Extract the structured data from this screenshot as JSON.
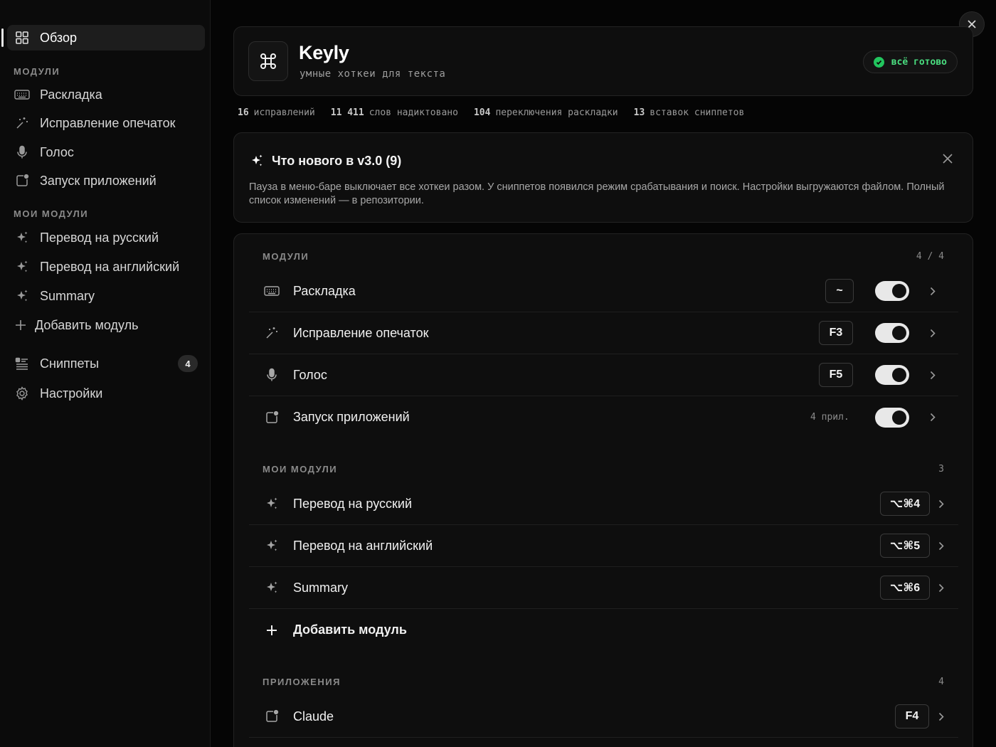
{
  "sidebar": {
    "overview": "Обзор",
    "modules_heading": "МОДУЛИ",
    "modules": [
      "Раскладка",
      "Исправление опечаток",
      "Голос",
      "Запуск приложений"
    ],
    "my_modules_heading": "МОИ МОДУЛИ",
    "my_modules": [
      "Перевод на русский",
      "Перевод на английский",
      "Summary"
    ],
    "add_module": "Добавить модуль",
    "snippets": "Сниппеты",
    "snippets_count": "4",
    "settings": "Настройки"
  },
  "header": {
    "title": "Keyly",
    "subtitle": "умные хоткеи для текста",
    "status": "всё готово"
  },
  "stats": [
    {
      "value": "16",
      "label": "исправлений"
    },
    {
      "value": "11 411",
      "label": "слов надиктовано"
    },
    {
      "value": "104",
      "label": "переключения раскладки"
    },
    {
      "value": "13",
      "label": "вставок сниппетов"
    }
  ],
  "news": {
    "title": "Что нового в v3.0 (9)",
    "body": "Пауза в меню-баре выключает все хоткеи разом. У сниппетов появился режим срабатывания и поиск. Настройки выгружаются файлом. Полный список изменений — в репозитории."
  },
  "modules_section": {
    "label": "МОДУЛИ",
    "count": "4 / 4",
    "rows": [
      {
        "label": "Раскладка",
        "shortcut": "~",
        "enabled": true
      },
      {
        "label": "Исправление опечаток",
        "shortcut": "F3",
        "enabled": true
      },
      {
        "label": "Голос",
        "shortcut": "F5",
        "enabled": true
      },
      {
        "label": "Запуск приложений",
        "meta": "4 прил.",
        "enabled": true
      }
    ]
  },
  "my_modules_section": {
    "label": "МОИ МОДУЛИ",
    "count": "3",
    "rows": [
      {
        "label": "Перевод на русский",
        "shortcut": "⌥⌘4"
      },
      {
        "label": "Перевод на английский",
        "shortcut": "⌥⌘5"
      },
      {
        "label": "Summary",
        "shortcut": "⌥⌘6"
      }
    ],
    "add_label": "Добавить модуль"
  },
  "apps_section": {
    "label": "ПРИЛОЖЕНИЯ",
    "count": "4",
    "rows": [
      {
        "label": "Claude",
        "shortcut": "F4"
      }
    ]
  },
  "colors": {
    "background": "#050505",
    "accent_green": "#22c55e",
    "card": "#0e0e0e"
  },
  "icons": [
    "grid-icon",
    "keyboard-icon",
    "wand-icon",
    "mic-icon",
    "app-launch-icon",
    "sparkle-icon",
    "plus-icon",
    "snippets-icon",
    "gear-icon",
    "command-icon",
    "check-icon",
    "close-icon",
    "chevron-right-icon"
  ]
}
